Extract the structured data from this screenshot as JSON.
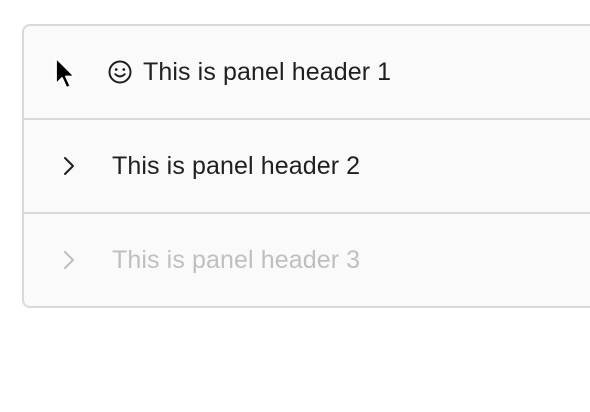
{
  "collapse": {
    "panels": [
      {
        "title": "This is panel header 1",
        "icon": "smile-icon",
        "disabled": false
      },
      {
        "title": "This is panel header 2",
        "icon": "chevron-right-icon",
        "disabled": false
      },
      {
        "title": "This is panel header 3",
        "icon": "chevron-right-icon",
        "disabled": true
      }
    ]
  },
  "colors": {
    "panel_background": "#fafafa",
    "border": "#d9d9d9",
    "text": "#1f1f1f",
    "disabled_text": "#bfbfbf"
  },
  "cursor": {
    "icon": "mouse-pointer-icon"
  }
}
